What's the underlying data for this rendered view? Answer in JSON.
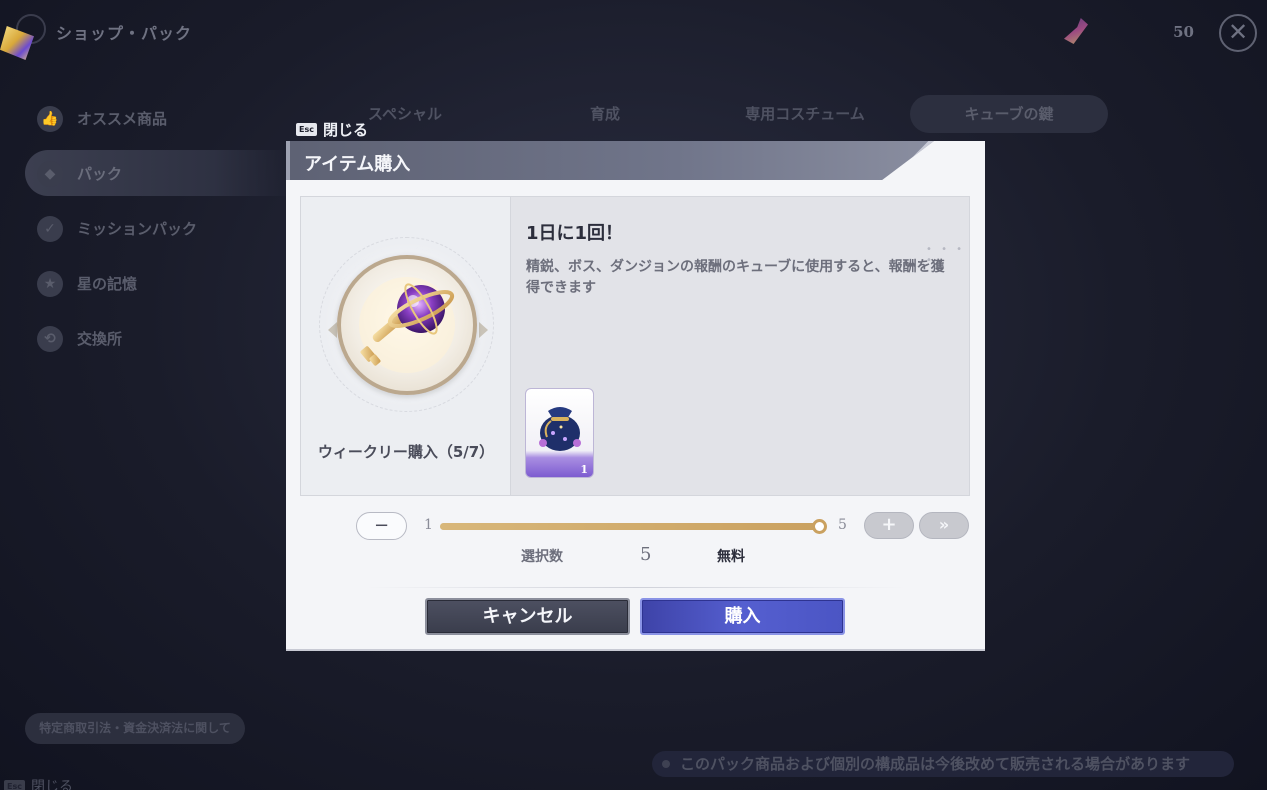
{
  "background": {
    "page_title": "ショップ・パック",
    "currency": {
      "icon": "gem-icon",
      "value": "50"
    },
    "sidebar": {
      "items": [
        {
          "label": "オススメ商品",
          "icon": "thumbs-up-icon",
          "active": false
        },
        {
          "label": "パック",
          "icon": "pack-icon",
          "active": true
        },
        {
          "label": "ミッションパック",
          "icon": "mission-icon",
          "active": false
        },
        {
          "label": "星の記憶",
          "icon": "star-memory-icon",
          "active": false
        },
        {
          "label": "交換所",
          "icon": "exchange-icon",
          "active": false
        }
      ]
    },
    "tabs": [
      {
        "label": "スペシャル",
        "active": false
      },
      {
        "label": "育成",
        "active": false
      },
      {
        "label": "専用コスチューム",
        "active": false
      },
      {
        "label": "キューブの鍵",
        "active": true
      }
    ],
    "legal_button": "特定商取引法・資金決済法に関して",
    "esc_key": "Esc",
    "close_label": "閉じる",
    "notice": "このパック商品および個別の構成品は今後改めて販売される場合があります"
  },
  "modal": {
    "esc_key": "Esc",
    "close_label": "閉じる",
    "title": "アイテム購入",
    "item": {
      "icon": "cube-key-icon",
      "purchase_limit": "ウィークリー購入（5/7）",
      "heading": "1日に1回！",
      "description": "精鋭、ボス、ダンジョンの報酬のキューブに使用すると、報酬を獲得できます",
      "reward": {
        "icon": "reward-bag-icon",
        "count": "1"
      }
    },
    "quantity": {
      "min": "1",
      "max": "5",
      "current": 5,
      "minus_label": "−",
      "plus_label": "+",
      "max_button_label": "»",
      "select_label": "選択数",
      "select_value": "5",
      "price_label": "無料"
    },
    "buttons": {
      "cancel": "キャンセル",
      "buy": "購入"
    }
  },
  "colors": {
    "accent_buy": "#4b55c4",
    "slider_fill": "#caa160",
    "modal_bg": "#f4f5f8"
  }
}
